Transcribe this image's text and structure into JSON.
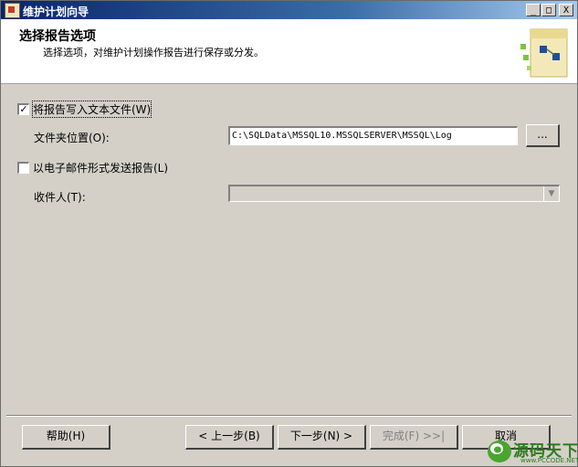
{
  "window": {
    "title": "维护计划向导",
    "controls": {
      "minimize": "_",
      "maximize": "□",
      "close": "X"
    }
  },
  "header": {
    "title": "选择报告选项",
    "subtitle": "选择选项，对维护计划操作报告进行保存或分发。"
  },
  "form": {
    "write_report": {
      "label": "将报告写入文本文件(W)",
      "checked": true
    },
    "folder_location": {
      "label": "文件夹位置(O):",
      "value": "C:\\SQLData\\MSSQL10.MSSQLSERVER\\MSSQL\\Log",
      "browse_label": "..."
    },
    "email_report": {
      "label": "以电子邮件形式发送报告(L)",
      "checked": false
    },
    "recipient": {
      "label": "收件人(T):",
      "value": ""
    }
  },
  "buttons": {
    "help": "帮助(H)",
    "back": "< 上一步(B)",
    "next": "下一步(N) >",
    "finish": "完成(F) >>|",
    "cancel": "取消"
  },
  "watermark": {
    "text": "源码天下",
    "url": "www.PCCODE.NET"
  }
}
